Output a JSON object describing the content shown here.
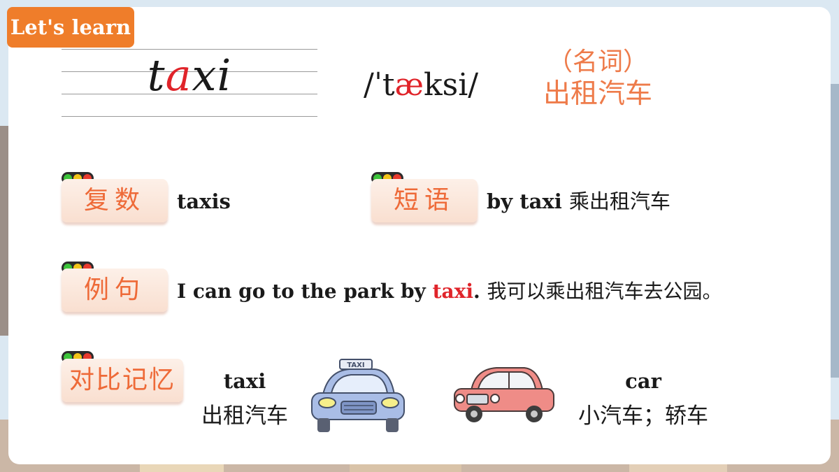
{
  "header": {
    "badge": "Let's learn"
  },
  "word": {
    "before": "t",
    "highlight": "a",
    "after": "xi"
  },
  "phonetic": {
    "before": "/ˈt",
    "highlight": "æ",
    "after": "ksi/"
  },
  "part_of_speech": "（名词）",
  "meaning": "出租汽车",
  "sections": {
    "plural": {
      "tag": "复数",
      "text": "taxis"
    },
    "phrase": {
      "tag": "短语",
      "text_en": "by taxi",
      "text_zh": "乘出租汽车"
    },
    "sentence": {
      "tag": "例句",
      "before": "I can go to the park by ",
      "highlight": "taxi",
      "after": ".",
      "translation": "我可以乘出租汽车去公园。"
    },
    "compare": {
      "tag": "对比记忆",
      "left_en": "taxi",
      "left_zh": "出租汽车",
      "right_en": "car",
      "right_zh": "小汽车；轿车",
      "taxi_sign": "TAXI"
    }
  },
  "colors": {
    "badge": "#ef7d2a",
    "accent_red": "#e0242a",
    "tag_text": "#ee6a38",
    "light_green": "#3cc43a",
    "light_yellow": "#f2c418",
    "light_red": "#e93b2e",
    "taxi_body": "#a9bde6",
    "car_body": "#ef8c87"
  },
  "icons": [
    "traffic-light-icon",
    "taxi-illustration",
    "car-illustration"
  ]
}
